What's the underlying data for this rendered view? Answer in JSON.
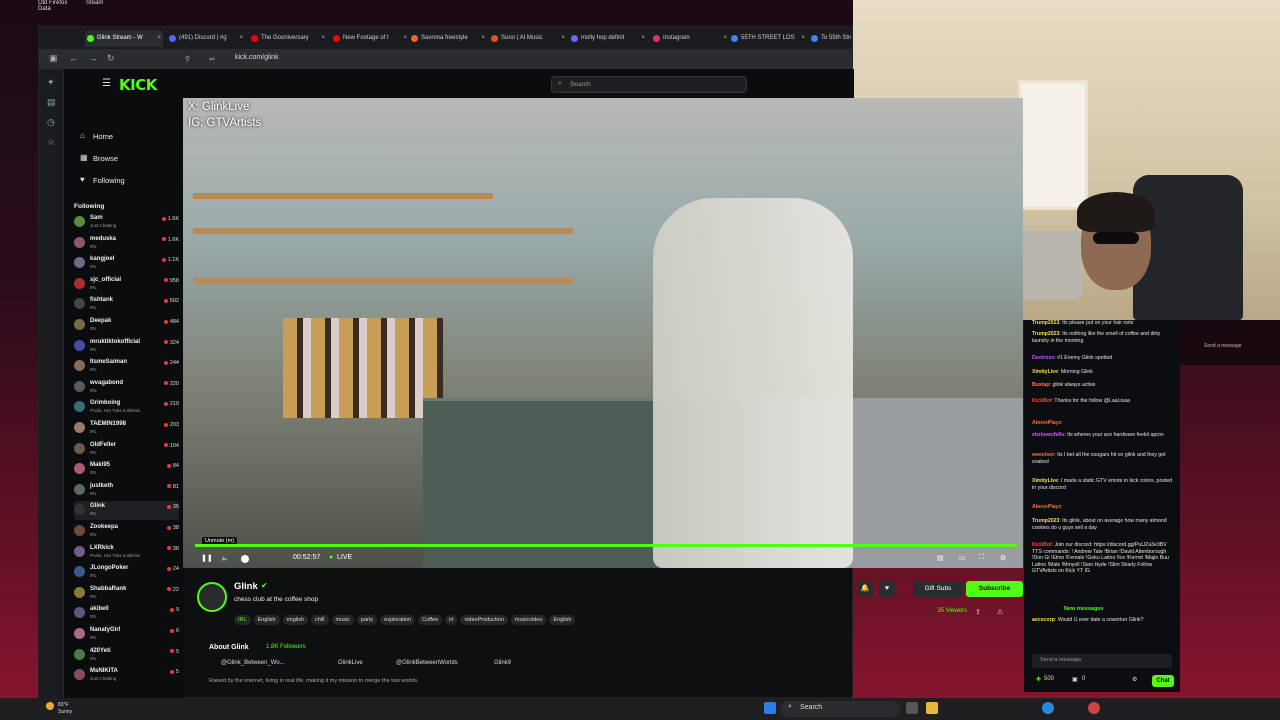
{
  "desktop": {
    "icons": [
      {
        "label": "Old Firefox Data"
      },
      {
        "label": "Steam"
      }
    ]
  },
  "browser": {
    "tabs": [
      {
        "label": "Glink Stream - W",
        "active": true,
        "color": "#53fc18"
      },
      {
        "label": "(491) Discord | #g",
        "color": "#5865f2"
      },
      {
        "label": "The Gooniversary",
        "color": "#ff0000"
      },
      {
        "label": "New Footage of I",
        "color": "#ff0000"
      },
      {
        "label": "Savrona freestyle",
        "color": "#f26522"
      },
      {
        "label": "Suno | AI Music",
        "color": "#e8541c"
      },
      {
        "label": "molly hop definit",
        "color": "#6a6aff"
      },
      {
        "label": "Instagram",
        "color": "#e1306c"
      },
      {
        "label": "55TH STREET LOS",
        "color": "#4285f4"
      },
      {
        "label": "To 55th Stre",
        "color": "#4285f4"
      }
    ],
    "url": "kick.com/glink"
  },
  "kick": {
    "logo": "KICK",
    "search_placeholder": "Search",
    "nav": {
      "home": "Home",
      "browse": "Browse",
      "following": "Following"
    },
    "following_header": "Following",
    "following": [
      {
        "name": "Sam",
        "category": "Just Chatting",
        "viewers": "1.6K",
        "color": "#5a8a3a"
      },
      {
        "name": "meduska",
        "category": "IRL",
        "viewers": "1.6K",
        "color": "#8a5a6a"
      },
      {
        "name": "kangjoel",
        "category": "IRL",
        "viewers": "1.1K",
        "color": "#6a6a8a"
      },
      {
        "name": "sjc_official",
        "category": "IRL",
        "viewers": "958",
        "color": "#aa3030"
      },
      {
        "name": "fishtank",
        "category": "IRL",
        "viewers": "502",
        "color": "#444"
      },
      {
        "name": "Deepak",
        "category": "IRL",
        "viewers": "484",
        "color": "#7a6a4a"
      },
      {
        "name": "mruktiktokofficial",
        "category": "IRL",
        "viewers": "324",
        "color": "#4a4aaa"
      },
      {
        "name": "ItsmeSaiman",
        "category": "IRL",
        "viewers": "244",
        "color": "#8a6a5a"
      },
      {
        "name": "wvagabond",
        "category": "IRL",
        "viewers": "220",
        "color": "#5a5a5a"
      },
      {
        "name": "Grimboing",
        "category": "Pools, Hot Tubs & Bikinis",
        "viewers": "219",
        "color": "#3a6a7a"
      },
      {
        "name": "TAEMIN1998",
        "category": "IRL",
        "viewers": "203",
        "color": "#9a7a6a"
      },
      {
        "name": "OldFeller",
        "category": "IRL",
        "viewers": "104",
        "color": "#6a5a4a"
      },
      {
        "name": "Maki95",
        "category": "IRL",
        "viewers": "84",
        "color": "#aa5a7a"
      },
      {
        "name": "justketh",
        "category": "IRL",
        "viewers": "81",
        "color": "#5a6a5a"
      },
      {
        "name": "Glink",
        "category": "IRL",
        "viewers": "35",
        "color": "#333",
        "selected": true
      },
      {
        "name": "Zookeepa",
        "category": "IRL",
        "viewers": "38",
        "color": "#6a4a3a"
      },
      {
        "name": "LXRkick",
        "category": "Pools, Hot Tubs & Bikinis",
        "viewers": "38",
        "color": "#7a5a8a"
      },
      {
        "name": "JLongoPoker",
        "category": "IRL",
        "viewers": "24",
        "color": "#3a5a8a"
      },
      {
        "name": "ShabbaRank",
        "category": "IRL",
        "viewers": "22",
        "color": "#8a7a3a"
      },
      {
        "name": "akibell",
        "category": "IRL",
        "viewers": "9",
        "color": "#5a5a7a"
      },
      {
        "name": "NanatyGirl",
        "category": "IRL",
        "viewers": "6",
        "color": "#aa6a8a"
      },
      {
        "name": "420Yeti",
        "category": "IRL",
        "viewers": "5",
        "color": "#4a7a4a"
      },
      {
        "name": "MsNIKITA",
        "category": "Just Chatting",
        "viewers": "5",
        "color": "#8a4a5a"
      }
    ],
    "video": {
      "overlay_line1": "X: GlinkLive",
      "overlay_line2": "IG: GTVArtists",
      "tooltip": "Unmute (m)",
      "time": "00:52:57",
      "live": "LIVE"
    },
    "channel": {
      "name": "Glink",
      "title": "chess club at the coffee shop",
      "tags": [
        "IRL",
        "English",
        "english",
        "chill",
        "music",
        "party",
        "exploration",
        "Coffee",
        "irl",
        "videoProduction",
        "musicvideo",
        "English"
      ],
      "gift_subs": "Gift Subs",
      "subscribe": "Subscribe",
      "viewers": "35 Viewers",
      "about": "About Glink",
      "followers": "1.8K Followers",
      "socials": [
        "@Glink_Between_Wo...",
        "GlinkLive",
        "@GlinkBetweenWorlds",
        "Glink9"
      ],
      "bio": "Raised by the internet, living in real life, making it my mission to merge the two worlds."
    },
    "chat": {
      "messages": [
        {
          "user": "Trump2023",
          "color": "#f2e14d",
          "text": "Its please put on your hair nets"
        },
        {
          "user": "Trump2023",
          "color": "#f2e14d",
          "text": "Its nothing like the smell of coffee and dirty laundry in the morning"
        },
        {
          "user": "Dextroxx",
          "color": "#c05cff",
          "text": "#1 Enemy Glink spotted"
        },
        {
          "user": "XimityLive",
          "color": "#f2e14d",
          "text": "Morning Glink"
        },
        {
          "user": "Buxtap",
          "color": "#ff7a5c",
          "text": "glink always active"
        },
        {
          "user": "KickBot",
          "color": "#ff4040",
          "text": "Thanks for the follow @LaaLisaa"
        },
        {
          "user": "AbovePlayz",
          "color": "#ff6a3a",
          "text": ""
        },
        {
          "user": "ebzlovechills",
          "color": "#e056ff",
          "text": "Its wheres your ace hardware feekit apron"
        },
        {
          "user": "weeeboo",
          "color": "#ff6a3a",
          "text": "Its I bet all the cougars hit on glink and they get soaked"
        },
        {
          "user": "XimityLive",
          "color": "#f2e14d",
          "text": "I made a static GTV emote in kick colors, posted in your discord"
        },
        {
          "user": "AbovePlayz",
          "color": "#ff6a3a",
          "text": ""
        },
        {
          "user": "Trump2023",
          "color": "#f2e14d",
          "text": "Its glink, about on average how many almond cookies do u guys sell a day"
        },
        {
          "user": "KickBot",
          "color": "#ff4040",
          "text": "Join our discord: https://discord.gg/PuUZa3e3BV TTS commands: ! Andrew Tate !Brian !David Attenborough !Don Gi !Elmo !Female !Goku Latino !Ice !Kermit !Majin Buu Latino !Male !Mmyoll !Sam Hyde !Slim Shady Follow GTVArtists on Kick YT IG"
        },
        {
          "user": "aecscorp",
          "color": "#f2e14d",
          "text": "Would U ever date a coworker Glink?"
        }
      ],
      "new_messages": "New messages",
      "input_placeholder": "Send a message",
      "points": "500",
      "count": "0",
      "chat_button": "Chat"
    },
    "side_chat": {
      "placeholder": "Send a message"
    }
  },
  "taskbar": {
    "weather_temp": "83°F",
    "weather_desc": "Sunny",
    "search": "Search"
  },
  "colors": {
    "kick_green": "#53fc18",
    "live_red": "#e83a3a"
  }
}
